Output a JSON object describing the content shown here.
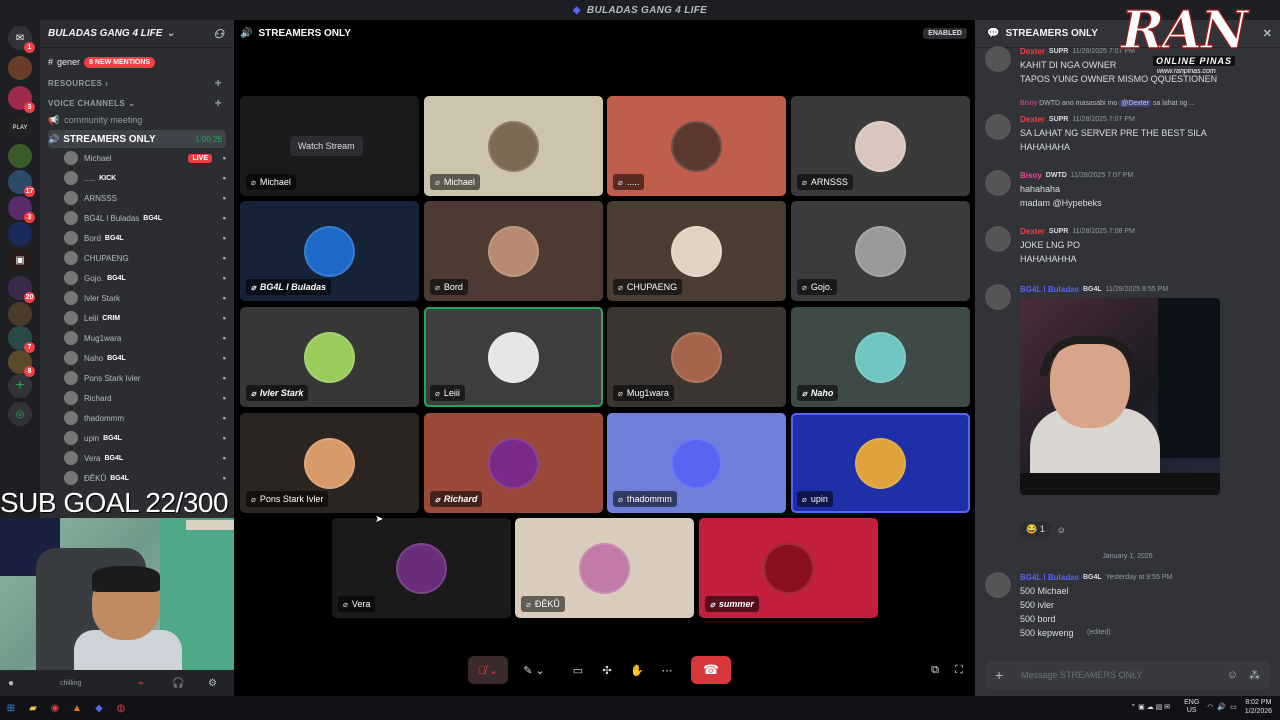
{
  "window": {
    "title": "BULADAS GANG 4 LIFE"
  },
  "servers": {
    "badges": [
      "1",
      "3",
      "17",
      "3",
      "20",
      "7",
      "8",
      "3"
    ],
    "play_label": "PLAY"
  },
  "channel_panel": {
    "server_name": "BULADAS GANG 4 LIFE",
    "general_label": "gener",
    "new_mentions": "8 NEW MENTIONS",
    "resources_label": "RESOURCES",
    "voice_channels_label": "VOICE CHANNELS",
    "community_meeting": "community meeting",
    "active_channel": "STREAMERS ONLY",
    "timer": "1:00:26",
    "voice_users": [
      {
        "name": "Michael",
        "tag": "",
        "status": "LIVE"
      },
      {
        "name": ".....",
        "tag": "KICK",
        "status": ""
      },
      {
        "name": "ARNSSS",
        "tag": "",
        "status": ""
      },
      {
        "name": "BG4L l Buladas",
        "tag": "BG4L",
        "status": ""
      },
      {
        "name": "Bord",
        "tag": "BG4L",
        "status": ""
      },
      {
        "name": "CHUPAENG",
        "tag": "",
        "status": ""
      },
      {
        "name": "Gojo.",
        "tag": "BG4L",
        "status": ""
      },
      {
        "name": "Ivler Stark",
        "tag": "",
        "status": ""
      },
      {
        "name": "Leiii",
        "tag": "CRIM",
        "status": ""
      },
      {
        "name": "Mug1wara",
        "tag": "",
        "status": ""
      },
      {
        "name": "Naho",
        "tag": "BG4L",
        "status": ""
      },
      {
        "name": "Pons Stark Ivler",
        "tag": "",
        "status": ""
      },
      {
        "name": "Richard",
        "tag": "",
        "status": ""
      },
      {
        "name": "thadommm",
        "tag": "",
        "status": ""
      },
      {
        "name": "upin",
        "tag": "BG4L",
        "status": ""
      },
      {
        "name": "Vera",
        "tag": "BG4L",
        "status": ""
      },
      {
        "name": "ĐÊKŮ",
        "tag": "BG4L",
        "status": ""
      }
    ],
    "user_status": "chilling"
  },
  "overlay": {
    "sub_goal": "SUB GOAL 22/300"
  },
  "call": {
    "header": "STREAMERS ONLY",
    "enabled_badge": "ENABLED",
    "watch_stream": "Watch Stream",
    "tiles": [
      {
        "name": "Michael",
        "color": "#1a1a1a",
        "avatar": "#2a2a2a",
        "style": "plain"
      },
      {
        "name": "Michael",
        "color": "#cdc4ad",
        "avatar": "#7c6a55",
        "style": "plain"
      },
      {
        "name": ".....",
        "color": "#c05d4c",
        "avatar": "#5a3a30",
        "style": "plain"
      },
      {
        "name": "ARNSSS",
        "color": "#3a3a3a",
        "avatar": "#d9c7bd",
        "style": "plain"
      },
      {
        "name": "BG4L l Buladas",
        "color": "#152238",
        "avatar": "#1f6ac9",
        "style": "bold"
      },
      {
        "name": "Bord",
        "color": "#4d3a33",
        "avatar": "#b78a6f",
        "style": "plain"
      },
      {
        "name": "CHUPAENG",
        "color": "#4a3e33",
        "avatar": "#e0d3c4",
        "style": "plain"
      },
      {
        "name": "Gojo.",
        "color": "#3b3b3b",
        "avatar": "#9a9a9a",
        "style": "plain"
      },
      {
        "name": "Ivler Stark",
        "color": "#373737",
        "avatar": "#9acc5c",
        "style": "bold"
      },
      {
        "name": "Leiii",
        "color": "#3d3d3d",
        "avatar": "#e6e6e6",
        "style": "plain"
      },
      {
        "name": "Mug1wara",
        "color": "#3a3531",
        "avatar": "#a6654a",
        "style": "plain"
      },
      {
        "name": "Naho",
        "color": "#3e4a45",
        "avatar": "#6fc5c0",
        "style": "bold"
      },
      {
        "name": "Pons Stark Ivler",
        "color": "#2a2520",
        "avatar": "#d99a6a",
        "style": "plain"
      },
      {
        "name": "Richard",
        "color": "#9b4a3a",
        "avatar": "#7a2a8a",
        "style": "bold"
      },
      {
        "name": "thadommm",
        "color": "#6f7fd9",
        "avatar": "#5865f2",
        "style": "plain"
      },
      {
        "name": "upin",
        "color": "#1f2fa8",
        "avatar": "#e0a23a",
        "style": "plain"
      },
      {
        "name": "Vera",
        "color": "#1a1a1a",
        "avatar": "#6a2d7a",
        "style": "plain"
      },
      {
        "name": "ĐÊKŮ",
        "color": "#d8cdbd",
        "avatar": "#c27aa9",
        "style": "plain"
      },
      {
        "name": "summer",
        "color": "#c2203e",
        "avatar": "#8a0f1f",
        "style": "bold"
      }
    ]
  },
  "chat": {
    "header": "STREAMERS ONLY",
    "messages": [
      {
        "user": "Dexter",
        "user_color": "#f23f43",
        "role": "SUPR",
        "time": "11/28/2025 7:07 PM",
        "lines": [
          "KAHIT DI NGA OWNER",
          "TAPOS YUNG OWNER MISMO QQUESTIONEN"
        ]
      },
      {
        "user": "Dexter",
        "user_color": "#f23f43",
        "role": "SUPR",
        "time": "11/28/2025 7:07 PM",
        "lines": [
          "SA LAHAT NG SERVER PRE THE BEST SILA",
          "HAHAHAHA"
        ]
      },
      {
        "user": "Bisoy",
        "user_color": "#eb459e",
        "role": "DWTD",
        "time": "11/28/2025 7:07 PM",
        "lines": [
          "hahahaha",
          "madam @Hypebeks"
        ]
      },
      {
        "user": "Dexter",
        "user_color": "#f23f43",
        "role": "SUPR",
        "time": "11/28/2025 7:08 PM",
        "lines": [
          "JOKE LNG PO",
          "HAHAHAHHA"
        ]
      },
      {
        "user": "BG4L l Buladas",
        "user_color": "#5865f2",
        "role": "BG4L",
        "time": "11/28/2025 8:55 PM",
        "lines": []
      },
      {
        "user": "BG4L l Buladas",
        "user_color": "#5865f2",
        "role": "BG4L",
        "time": "Yesterday at 9:55 PM",
        "lines": [
          "500 Michael",
          "500 ivler",
          "500 bord",
          "500 kepweng"
        ]
      }
    ],
    "reply_preview": {
      "user": "Bisoy",
      "role": "DWTD",
      "text": "ano masasabi mo",
      "mention": "@Dexter",
      "tail": "sa lahat ng ..."
    },
    "reaction_count": "1",
    "date_separator": "January 1, 2026",
    "edited": "(edited)",
    "input_placeholder": "Message STREAMERS ONLY"
  },
  "brand": {
    "logo": "RAN",
    "subtitle": "ONLINE PINAS",
    "url": "www.ranpinas.com"
  },
  "taskbar": {
    "lang_top": "ENG",
    "lang_bottom": "US",
    "time": "8:02 PM",
    "date": "1/2/2026"
  }
}
